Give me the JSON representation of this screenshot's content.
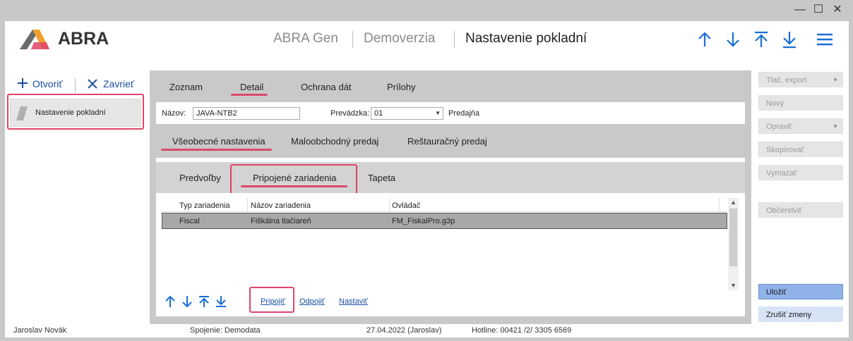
{
  "window": {
    "minimize": "—",
    "maximize": "☐",
    "close": "✕"
  },
  "header": {
    "logo_text": "ABRA",
    "crumbs": [
      "ABRA Gen",
      "Demoverzia",
      "Nastavenie pokladní"
    ]
  },
  "left": {
    "open_label": "Otvoriť",
    "close_label": "Zavrieť",
    "item_label": "Nastavenie pokladní"
  },
  "main_tabs": [
    "Zoznam",
    "Detail",
    "Ochrana dát",
    "Prílohy"
  ],
  "form": {
    "name_label": "Názov:",
    "name_value": "JAVA-NTB2",
    "shop_label": "Prevádzka:",
    "shop_value": "01",
    "shop_name": "Predajňa"
  },
  "sub_tabs": [
    "Všeobecné nastavenia",
    "Maloobchodný predaj",
    "Reštauračný predaj"
  ],
  "inner_tabs": [
    "Predvoľby",
    "Pripojené zariadenia",
    "Tapeta"
  ],
  "grid": {
    "columns": [
      "Typ zariadenia",
      "Názov zariadenia",
      "Ovládač"
    ],
    "rows": [
      [
        "Fiscal",
        "Fiškálna tlačiareň",
        "FM_FiskalPro.g3p"
      ]
    ]
  },
  "actions": {
    "connect": "Pripojiť",
    "disconnect": "Odpojiť",
    "configure": "Nastaviť"
  },
  "right_buttons": {
    "print": "Tlač, export",
    "new": "Nový",
    "edit": "Opraviť",
    "copy": "Skopírovať",
    "delete": "Vymazať",
    "refresh": "Občerstviť",
    "save": "Uložiť",
    "cancel": "Zrušiť zmeny"
  },
  "status": {
    "user": "Jaroslav Novák",
    "connection": "Spojenie: Demodata",
    "date": "27.04.2022 (Jaroslav)",
    "hotline": "Hotline: 00421 /2/ 3305 6569"
  },
  "colors": {
    "accent": "#1a6fd4",
    "highlight": "#e0446a",
    "save_bg": "#8fb3e8"
  }
}
